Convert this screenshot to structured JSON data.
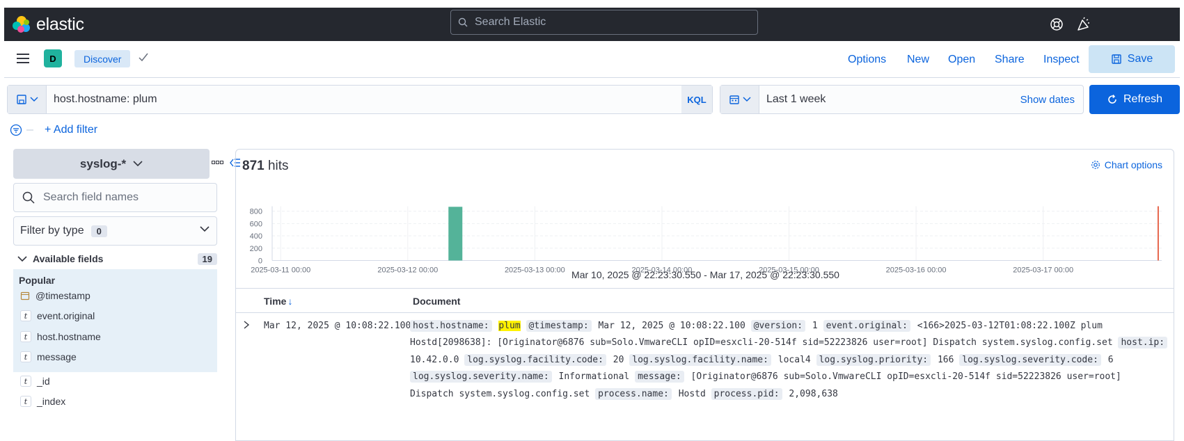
{
  "topbar": {
    "logo_text": "elastic",
    "search_placeholder": "Search Elastic"
  },
  "appbar": {
    "space_badge": "D",
    "breadcrumb": "Discover",
    "menu": [
      "Options",
      "New",
      "Open",
      "Share",
      "Inspect"
    ],
    "save_label": "Save"
  },
  "query": {
    "text": "host.hostname: plum",
    "language": "KQL"
  },
  "time": {
    "range_label": "Last 1 week",
    "show_dates": "Show dates",
    "refresh_label": "Refresh"
  },
  "filters": {
    "add_filter": "+ Add filter"
  },
  "sidebar": {
    "index_pattern": "syslog-*",
    "field_search_placeholder": "Search field names",
    "filter_by_type": "Filter by type",
    "filter_count": "0",
    "available_fields_label": "Available fields",
    "available_count": "19",
    "popular_label": "Popular",
    "popular_fields": [
      {
        "name": "@timestamp",
        "type": "date"
      },
      {
        "name": "event.original",
        "type": "t"
      },
      {
        "name": "host.hostname",
        "type": "t"
      },
      {
        "name": "message",
        "type": "t"
      }
    ],
    "other_fields": [
      {
        "name": "_id",
        "type": "t"
      },
      {
        "name": "_index",
        "type": "t"
      }
    ]
  },
  "results": {
    "hits_count": "871",
    "hits_label": "hits",
    "chart_options": "Chart options",
    "time_range_text": "Mar 10, 2025 @ 22:23:30.550 - Mar 17, 2025 @ 22:23:30.550",
    "col_time": "Time",
    "col_document": "Document",
    "row": {
      "time": "Mar 12, 2025 @ 10:08:22.100",
      "doc": [
        {
          "k": "host.hostname:",
          "v": "plum",
          "hl": true
        },
        {
          "k": "@timestamp:",
          "v": "Mar 12, 2025 @ 10:08:22.100"
        },
        {
          "k": "@version:",
          "v": "1"
        },
        {
          "k": "event.original:",
          "v": "<166>2025-03-12T01:08:22.100Z plum Hostd[2098638]: [Originator@6876 sub=Solo.VmwareCLI opID=esxcli-20-514f sid=52223826 user=root] Dispatch system.syslog.config.set"
        },
        {
          "k": "host.ip:",
          "v": "10.42.0.0"
        },
        {
          "k": "log.syslog.facility.code:",
          "v": "20"
        },
        {
          "k": "log.syslog.facility.name:",
          "v": "local4"
        },
        {
          "k": "log.syslog.priority:",
          "v": "166"
        },
        {
          "k": "log.syslog.severity.code:",
          "v": "6"
        },
        {
          "k": "log.syslog.severity.name:",
          "v": "Informational"
        },
        {
          "k": "message:",
          "v": "[Originator@6876 sub=Solo.VmwareCLI opID=esxcli-20-514f sid=52223826 user=root] Dispatch system.syslog.config.set"
        },
        {
          "k": "process.name:",
          "v": "Hostd"
        },
        {
          "k": "process.pid:",
          "v": "2,098,638"
        }
      ]
    }
  },
  "chart_data": {
    "type": "bar",
    "x_ticks": [
      "2025-03-11 00:00",
      "2025-03-12 00:00",
      "2025-03-13 00:00",
      "2025-03-14 00:00",
      "2025-03-15 00:00",
      "2025-03-16 00:00",
      "2025-03-17 00:00"
    ],
    "y_ticks": [
      0,
      200,
      400,
      600,
      800
    ],
    "ylim": [
      0,
      871
    ],
    "bars": [
      {
        "x": "2025-03-12 09:00",
        "value": 871
      }
    ],
    "now_marker": "2025-03-17 22:23",
    "bar_color": "#54b399",
    "marker_color": "#e7664c"
  }
}
